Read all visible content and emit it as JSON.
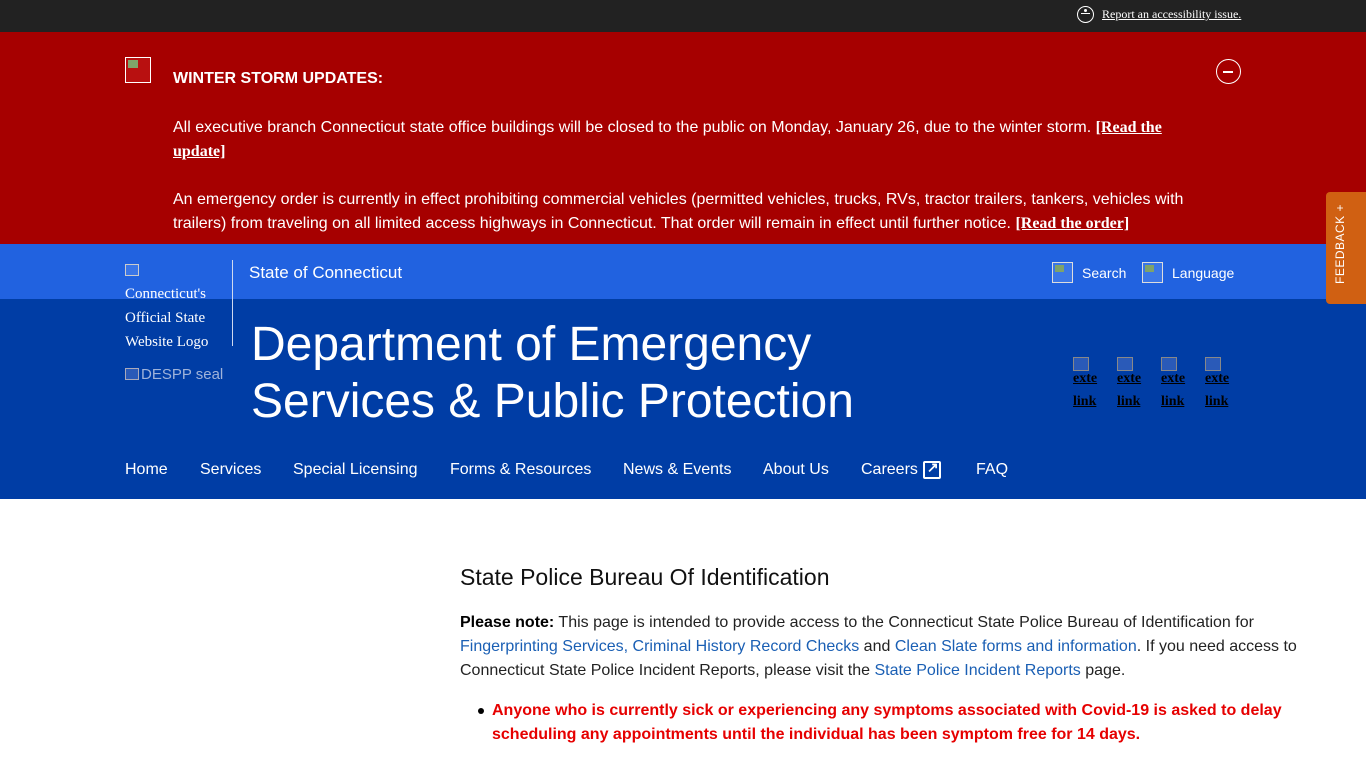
{
  "topbar": {
    "accessibility_link": "Report an accessibility issue."
  },
  "alert": {
    "title": "WINTER STORM UPDATES:",
    "p1_text": "All executive branch Connecticut state office buildings will be closed to the public on Monday, January 26, due to the winter storm. ",
    "p1_link": "[Read the update]",
    "p2_text": "An emergency order is currently in effect prohibiting commercial vehicles (permitted vehicles, trucks, RVs, tractor trailers, tankers, vehicles with trailers) from traveling on all limited access highways in Connecticut. That order will remain in effect until further notice. ",
    "p2_link": "[Read the order]",
    "bg_color": "#a60000"
  },
  "statebar": {
    "state_name": "State of Connecticut",
    "search_label": "Search",
    "language_label": "Language",
    "bg_color": "#2162e0"
  },
  "header": {
    "ct_logo_alt": "Connecticut's Official State Website Logo",
    "seal_alt": "DESPP seal",
    "dept_title": "Department of Emergency Services & Public Protection",
    "social_links": [
      "exte link",
      "exte link",
      "exte link",
      "exte link"
    ],
    "bg_color": "#003da5"
  },
  "nav": {
    "items": [
      "Home",
      "Services",
      "Special Licensing",
      "Forms & Resources",
      "News & Events",
      "About Us",
      "Careers",
      "FAQ"
    ]
  },
  "feedback": {
    "label": "FEEDBACK +",
    "color": "#d06012"
  },
  "main": {
    "page_title": "State Police Bureau Of Identification",
    "note_label": "Please note:",
    "note_text1": "  This page is intended to provide access to the Connecticut State Police Bureau of Identification for ",
    "note_link1": "Fingerprinting Services, Criminal History Record Checks",
    "note_text2": " and ",
    "note_link2": "Clean Slate forms and information",
    "note_text3": ". If you need access to Connecticut State Police Incident Reports, please visit the ",
    "note_link3": "State Police Incident Reports",
    "note_text4": " page.",
    "bullets": [
      "Anyone who is currently sick or experiencing any symptoms associated with Covid-19 is asked to delay scheduling any appointments until the individual has been symptom free for 14 days."
    ]
  }
}
